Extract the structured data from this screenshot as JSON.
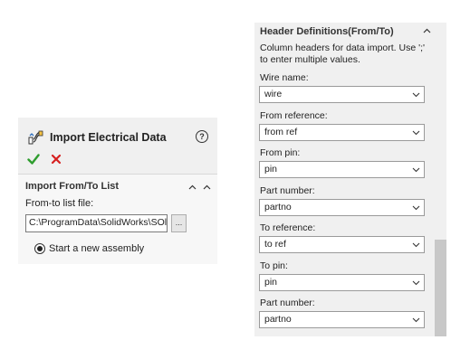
{
  "import_panel": {
    "title": "Import Electrical Data",
    "help_glyph": "?",
    "section_title": "Import From/To List",
    "file_label": "From-to list file:",
    "file_path": "C:\\ProgramData\\SolidWorks\\SOl",
    "browse_label": "...",
    "radio_label": "Start a new assembly",
    "radio_selected": true
  },
  "header_definitions": {
    "title": "Header Definitions(From/To)",
    "description": "Column headers for data import. Use ';' to enter multiple values.",
    "fields": [
      {
        "label": "Wire name:",
        "value": "wire"
      },
      {
        "label": "From reference:",
        "value": "from ref"
      },
      {
        "label": "From pin:",
        "value": "pin"
      },
      {
        "label": "Part number:",
        "value": "partno"
      },
      {
        "label": "To reference:",
        "value": "to ref"
      },
      {
        "label": "To pin:",
        "value": "pin"
      },
      {
        "label": "Part number:",
        "value": "partno"
      }
    ]
  },
  "colors": {
    "ok_green": "#2e9d2e",
    "cancel_red": "#d62020",
    "panel_bg": "#f0f0f0"
  }
}
